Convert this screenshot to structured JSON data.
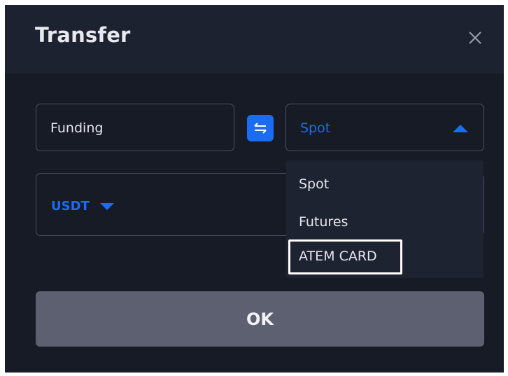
{
  "dialog": {
    "title": "Transfer",
    "close_icon": "close-icon"
  },
  "transfer": {
    "from_account": "Funding",
    "swap_icon": "swap-arrows-icon",
    "to_account": "Spot",
    "to_caret_icon": "chevron-up-icon"
  },
  "amount": {
    "coin": "USDT",
    "coin_caret_icon": "chevron-down-icon"
  },
  "dropdown": {
    "options": [
      {
        "label": "Spot"
      },
      {
        "label": "Futures"
      },
      {
        "label": "ATEM CARD",
        "highlighted": true
      }
    ]
  },
  "actions": {
    "ok_label": "OK"
  },
  "colors": {
    "accent": "#1a6cf2",
    "dialog_bg": "#161b26",
    "header_bg": "#1d2230",
    "button_disabled": "#5d6070",
    "highlight_border": "#ffffff"
  }
}
